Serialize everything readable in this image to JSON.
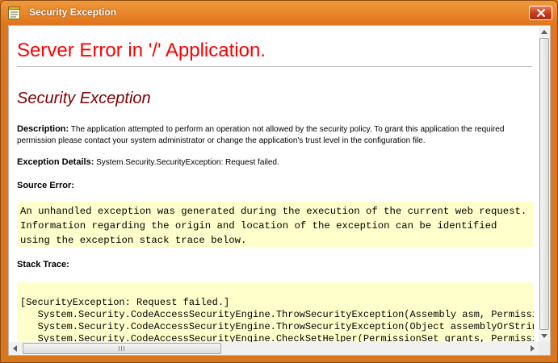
{
  "window": {
    "title": "Security Exception",
    "icon": "notepad-icon",
    "close_icon": "close-icon"
  },
  "page": {
    "heading": "Server Error in '/' Application.",
    "subheading": "Security Exception",
    "description_label": "Description:",
    "description_text": "The application attempted to perform an operation not allowed by the security policy.  To grant this application the required permission please contact your system administrator or change the application's trust level in the configuration file.",
    "exception_label": "Exception Details:",
    "exception_text": "System.Security.SecurityException: Request failed.",
    "source_error_label": "Source Error:",
    "source_error_text": "An unhandled exception was generated during the execution of the current web request. Information regarding the origin and location of the exception can be identified using the exception stack trace below.",
    "stack_trace_label": "Stack Trace:",
    "stack_trace_lines": [
      "[SecurityException: Request failed.]",
      "   System.Security.CodeAccessSecurityEngine.ThrowSecurityException(Assembly asm, PermissionSet granted, PermissionSet refused",
      "   System.Security.CodeAccessSecurityEngine.ThrowSecurityException(Object assemblyOrString, PermissionSet granted, Permission",
      "   System.Security.CodeAccessSecurityEngine.CheckSetHelper(PermissionSet grants, PermissionSet refused, PermissionSet demands"
    ]
  },
  "colors": {
    "frame": "#d9771f",
    "heading": "#ff0000",
    "subheading": "#800000",
    "code_background": "#ffffcc"
  }
}
